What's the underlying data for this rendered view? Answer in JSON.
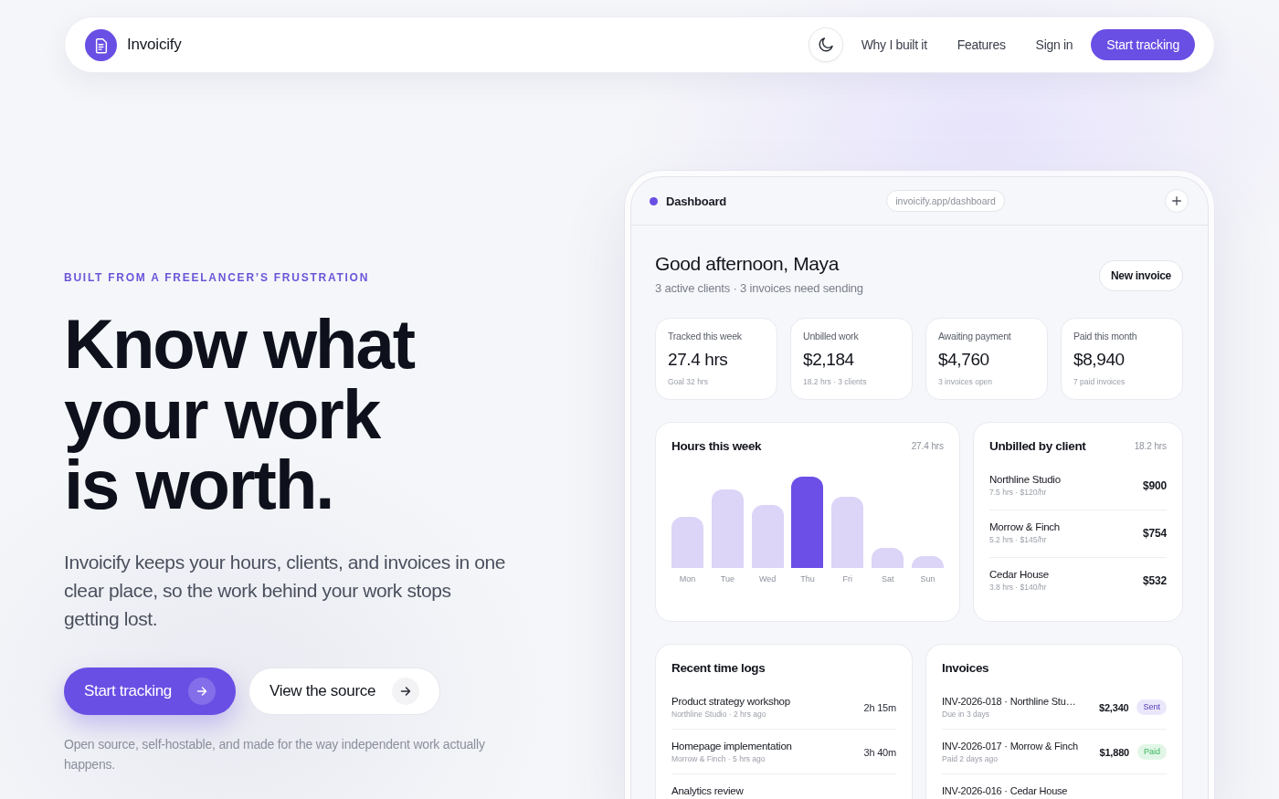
{
  "nav": {
    "brand": "Invoicify",
    "links": [
      "Why I built it",
      "Features",
      "Sign in"
    ],
    "cta": "Start tracking"
  },
  "hero": {
    "eyebrow": "BUILT FROM A FREELANCER’S FRUSTRATION",
    "headline": "Know what your work is worth.",
    "description": "Invoicify keeps your hours, clients, and invoices in one clear place, so the work behind your work stops getting lost.",
    "primary_button": "Start tracking",
    "secondary_button": "View the source",
    "note": "Open source, self-hostable, and made for the way independent work actually happens."
  },
  "dashboard": {
    "title": "Dashboard",
    "url": "invoicify.app/dashboard",
    "greeting": "Good afternoon, Maya",
    "summary": "3 active clients · 3 invoices need sending",
    "new_invoice_button": "New invoice",
    "stats": [
      {
        "label": "Tracked this week",
        "value": "27.4 hrs",
        "detail": "Goal 32 hrs"
      },
      {
        "label": "Unbilled work",
        "value": "$2,184",
        "detail": "18.2 hrs · 3 clients"
      },
      {
        "label": "Awaiting payment",
        "value": "$4,760",
        "detail": "3 invoices open"
      },
      {
        "label": "Paid this month",
        "value": "$8,940",
        "detail": "7 paid invoices"
      }
    ],
    "hours_chart": {
      "title": "Hours this week",
      "total": "27.4 hrs",
      "days": [
        {
          "label": "Mon",
          "highlighted": false
        },
        {
          "label": "Tue",
          "highlighted": false
        },
        {
          "label": "Wed",
          "highlighted": false
        },
        {
          "label": "Thu",
          "highlighted": true
        },
        {
          "label": "Fri",
          "highlighted": false
        },
        {
          "label": "Sat",
          "highlighted": false
        },
        {
          "label": "Sun",
          "highlighted": false
        }
      ]
    },
    "unbilled": {
      "title": "Unbilled by client",
      "total": "18.2 hrs",
      "clients": [
        {
          "name": "Northline Studio",
          "detail": "7.5 hrs · $120/hr",
          "amount": "$900"
        },
        {
          "name": "Morrow & Finch",
          "detail": "5.2 hrs · $145/hr",
          "amount": "$754"
        },
        {
          "name": "Cedar House",
          "detail": "3.8 hrs · $140/hr",
          "amount": "$532"
        }
      ]
    },
    "time_logs": {
      "title": "Recent time logs",
      "entries": [
        {
          "task": "Product strategy workshop",
          "detail": "Northline Studio · 2 hrs ago",
          "duration": "2h 15m"
        },
        {
          "task": "Homepage implementation",
          "detail": "Morrow & Finch · 5 hrs ago",
          "duration": "3h 40m"
        },
        {
          "task": "Analytics review"
        }
      ]
    },
    "invoices": {
      "title": "Invoices",
      "entries": [
        {
          "title": "INV-2026-018 · Northline Stu…",
          "detail": "Due in 3 days",
          "amount": "$2,340",
          "status": "Sent",
          "color": "#ebe7fb"
        },
        {
          "title": "INV-2026-017 · Morrow & Finch",
          "detail": "Paid 2 days ago",
          "amount": "$1,880",
          "status": "Paid",
          "color": "#e1f6e7"
        },
        {
          "title": "INV-2026-016 · Cedar House"
        }
      ]
    }
  }
}
